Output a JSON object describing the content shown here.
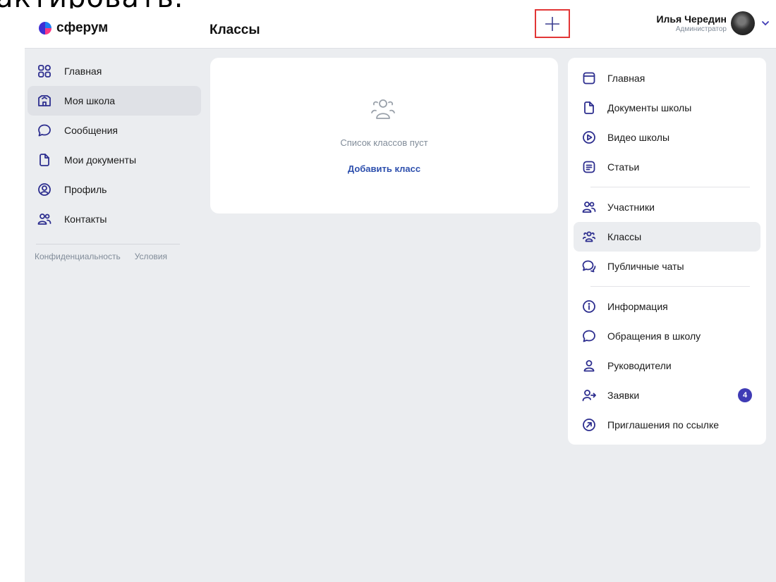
{
  "caption": "актировать.",
  "header": {
    "logo_text": "сферум",
    "page_title": "Классы",
    "plus_button": "+",
    "user_name": "Илья Чередин",
    "user_role": "Администратор"
  },
  "sidebar": {
    "items": [
      {
        "label": "Главная",
        "icon": "grid-icon"
      },
      {
        "label": "Моя школа",
        "icon": "school-icon"
      },
      {
        "label": "Сообщения",
        "icon": "chat-icon"
      },
      {
        "label": "Мои документы",
        "icon": "document-icon"
      },
      {
        "label": "Профиль",
        "icon": "profile-icon"
      },
      {
        "label": "Контакты",
        "icon": "contacts-icon"
      }
    ],
    "footer": {
      "privacy": "Конфиденциальность",
      "terms": "Условия"
    }
  },
  "main": {
    "empty_text": "Список классов пуст",
    "add_class": "Добавить класс"
  },
  "right_menu": {
    "group1": [
      {
        "label": "Главная",
        "icon": "square-icon"
      },
      {
        "label": "Документы школы",
        "icon": "document-icon"
      },
      {
        "label": "Видео школы",
        "icon": "play-icon"
      },
      {
        "label": "Статьи",
        "icon": "article-icon"
      }
    ],
    "group2": [
      {
        "label": "Участники",
        "icon": "users-icon"
      },
      {
        "label": "Классы",
        "icon": "classes-icon"
      },
      {
        "label": "Публичные чаты",
        "icon": "chats-icon"
      }
    ],
    "group3": [
      {
        "label": "Информация",
        "icon": "info-icon"
      },
      {
        "label": "Обращения в школу",
        "icon": "chat-icon"
      },
      {
        "label": "Руководители",
        "icon": "person-icon"
      },
      {
        "label": "Заявки",
        "icon": "person-arrow-icon",
        "badge": "4"
      },
      {
        "label": "Приглашения по ссылке",
        "icon": "link-arrow-icon"
      }
    ]
  },
  "colors": {
    "accent": "#3f3bb5",
    "highlight_box": "#e23636",
    "background": "#ebedf0"
  }
}
